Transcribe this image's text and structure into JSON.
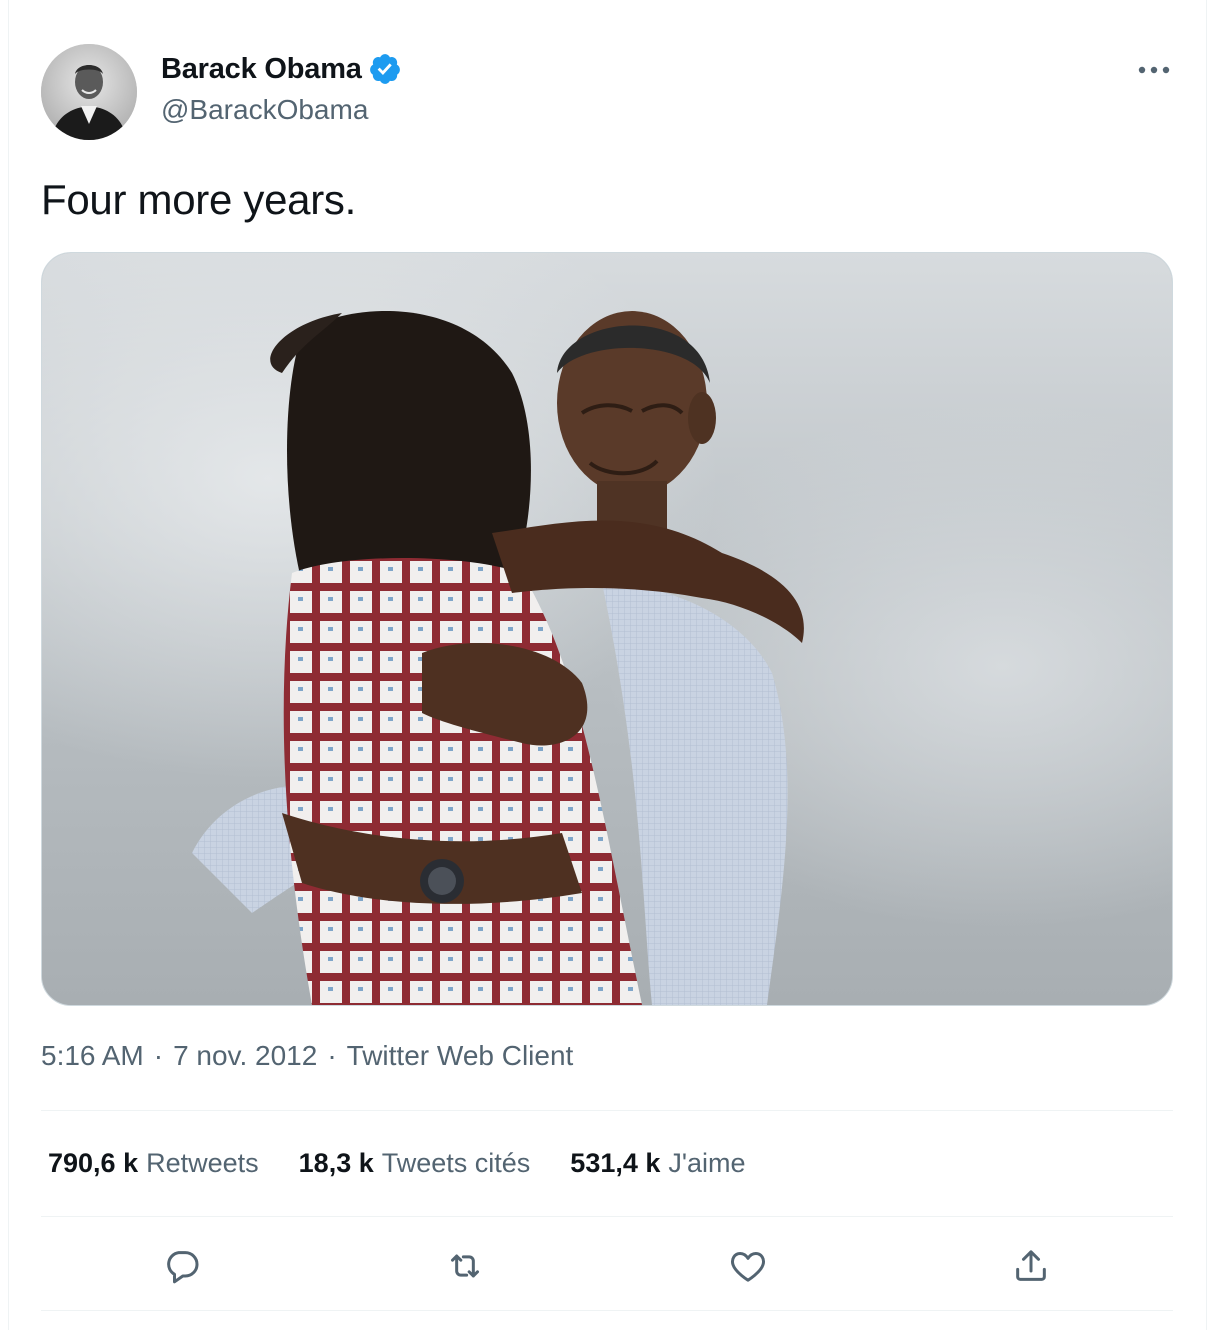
{
  "author": {
    "name": "Barack Obama",
    "handle": "@BarackObama",
    "verified_icon": "verified-badge-icon",
    "avatar_icon": "profile-photo"
  },
  "tweet": {
    "text": "Four more years.",
    "media_icon": "photo-couple-embracing"
  },
  "meta": {
    "time": "5:16 AM",
    "separator": "·",
    "date": "7 nov. 2012",
    "source": "Twitter Web Client"
  },
  "stats": {
    "retweets_count": "790,6 k",
    "retweets_label": "Retweets",
    "quotes_count": "18,3 k",
    "quotes_label": "Tweets cités",
    "likes_count": "531,4 k",
    "likes_label": "J'aime"
  },
  "actions": [
    "reply-icon",
    "retweet-icon",
    "like-icon",
    "share-icon"
  ],
  "colors": {
    "verified": "#1d9bf0",
    "secondary_text": "#536471",
    "divider": "#eff3f4"
  }
}
